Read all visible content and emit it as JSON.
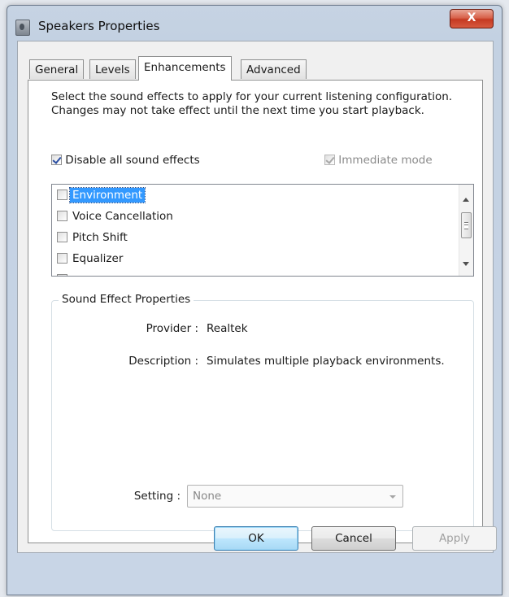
{
  "window": {
    "title": "Speakers Properties",
    "close_glyph": "X"
  },
  "tabs": [
    {
      "label": "General"
    },
    {
      "label": "Levels"
    },
    {
      "label": "Enhancements"
    },
    {
      "label": "Advanced"
    }
  ],
  "enhancements": {
    "description": "Select the sound effects to apply for your current listening configuration. Changes may not take effect until the next time you start playback.",
    "disable_all": {
      "label": "Disable all sound effects",
      "checked": true
    },
    "immediate_mode": {
      "label": "Immediate mode",
      "checked": true,
      "enabled": false
    },
    "effects": [
      {
        "label": "Environment",
        "checked": false,
        "selected": true
      },
      {
        "label": "Voice Cancellation",
        "checked": false
      },
      {
        "label": "Pitch Shift",
        "checked": false
      },
      {
        "label": "Equalizer",
        "checked": false
      }
    ],
    "properties": {
      "group_title": "Sound Effect Properties",
      "provider_label": "Provider :",
      "provider_value": "Realtek",
      "description_label": "Description :",
      "description_value": "Simulates multiple playback environments.",
      "setting_label": "Setting :",
      "setting_value": "None"
    }
  },
  "buttons": {
    "ok": "OK",
    "cancel": "Cancel",
    "apply": "Apply"
  }
}
